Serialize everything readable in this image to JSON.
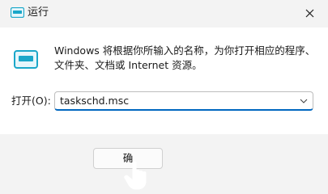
{
  "window": {
    "title": "运行",
    "close_icon": "close-icon",
    "app_icon": "run-icon"
  },
  "dialog": {
    "description": "Windows 将根据你所输入的名称，为你打开相应的程序、文件夹、文档或 Internet 资源。",
    "open_label": "打开(O):",
    "open_value": "taskschd.msc",
    "ok_label": "确"
  },
  "colors": {
    "accent": "#0067c0",
    "icon_blue": "#1aa7c9"
  }
}
